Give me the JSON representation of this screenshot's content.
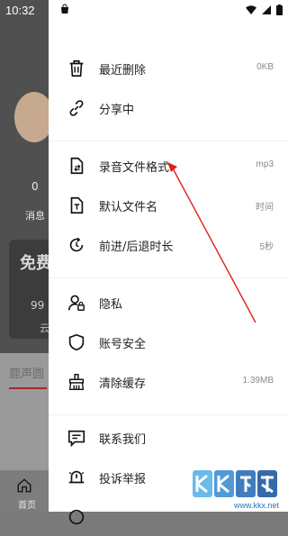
{
  "status_bar": {
    "time": "10:32"
  },
  "background_app": {
    "count": "0",
    "message_label": "消息",
    "card_title": "免费",
    "card_number": "99",
    "card_sub": "云",
    "tab_label": "鹿声圆",
    "nav_home_label": "首页"
  },
  "drawer": {
    "groups": [
      [
        {
          "label": "最近删除",
          "value": "0KB",
          "icon": "trash-icon"
        },
        {
          "label": "分享中",
          "value": "",
          "icon": "link-icon"
        }
      ],
      [
        {
          "label": "录音文件格式",
          "value": "mp3",
          "icon": "file-format-icon"
        },
        {
          "label": "默认文件名",
          "value": "时间",
          "icon": "file-name-icon"
        },
        {
          "label": "前进/后退时长",
          "value": "5秒",
          "icon": "timer-icon"
        }
      ],
      [
        {
          "label": "隐私",
          "value": "",
          "icon": "privacy-icon"
        },
        {
          "label": "账号安全",
          "value": "",
          "icon": "shield-icon"
        },
        {
          "label": "清除缓存",
          "value": "1.39MB",
          "icon": "broom-icon"
        }
      ],
      [
        {
          "label": "联系我们",
          "value": "",
          "icon": "chat-icon"
        },
        {
          "label": "投诉举报",
          "value": "",
          "icon": "bell-icon"
        }
      ]
    ]
  },
  "watermark": {
    "url": "www.kkx.net"
  },
  "colors": {
    "annotation_arrow": "#e02020",
    "divider": "#efefef"
  }
}
